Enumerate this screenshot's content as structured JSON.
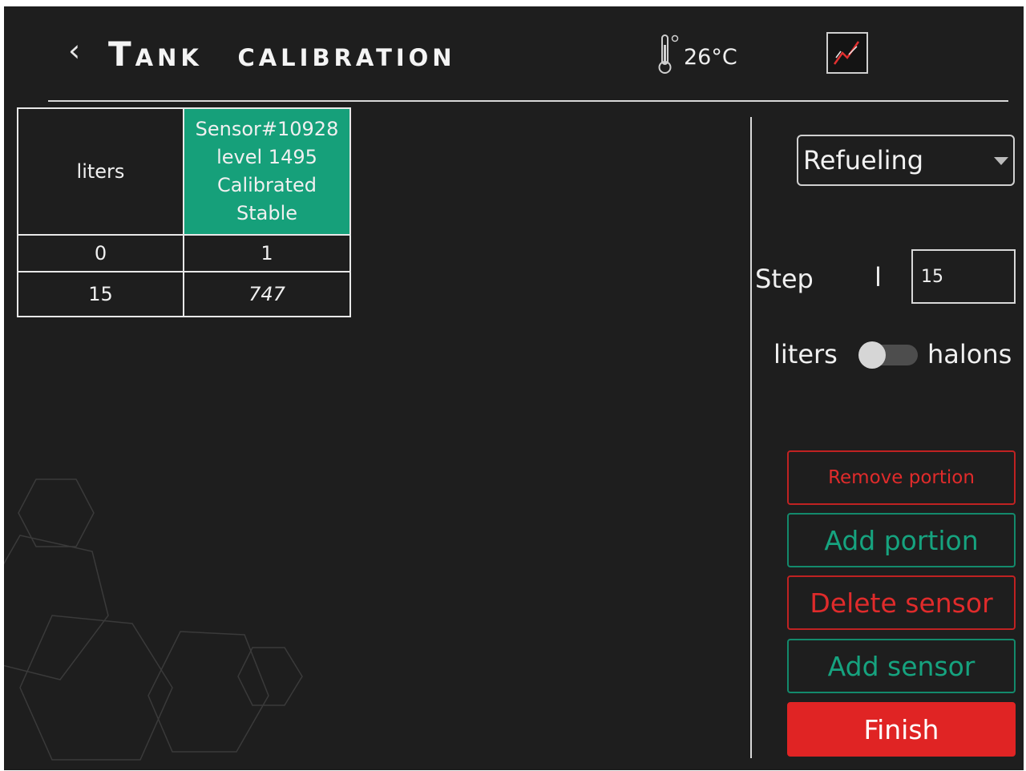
{
  "header": {
    "back_icon": "chevron-left-icon",
    "title": "Tank calibration",
    "temperature": "26°C",
    "thermometer_icon": "thermometer-icon",
    "chart_icon": "chart-icon"
  },
  "table": {
    "col1_header": "liters",
    "sensor_header": {
      "line1": "Sensor#10928",
      "line2": "level 1495",
      "line3": "Calibrated",
      "line4": "Stable"
    },
    "rows": [
      {
        "liters": "0",
        "sensor": "1"
      },
      {
        "liters": "15",
        "sensor": "747"
      }
    ]
  },
  "controls": {
    "mode": "Refueling",
    "step_label": "Step",
    "step_unit": "l",
    "step_value": "15",
    "unit_left": "liters",
    "unit_right": "halons",
    "unit_toggle_on": false
  },
  "buttons": {
    "remove_portion": "Remove portion",
    "add_portion": "Add portion",
    "delete_sensor": "Delete sensor",
    "add_sensor": "Add sensor",
    "finish": "Finish"
  },
  "colors": {
    "background": "#1e1e1e",
    "accent_green": "#16a07a",
    "accent_red": "#e02424"
  }
}
